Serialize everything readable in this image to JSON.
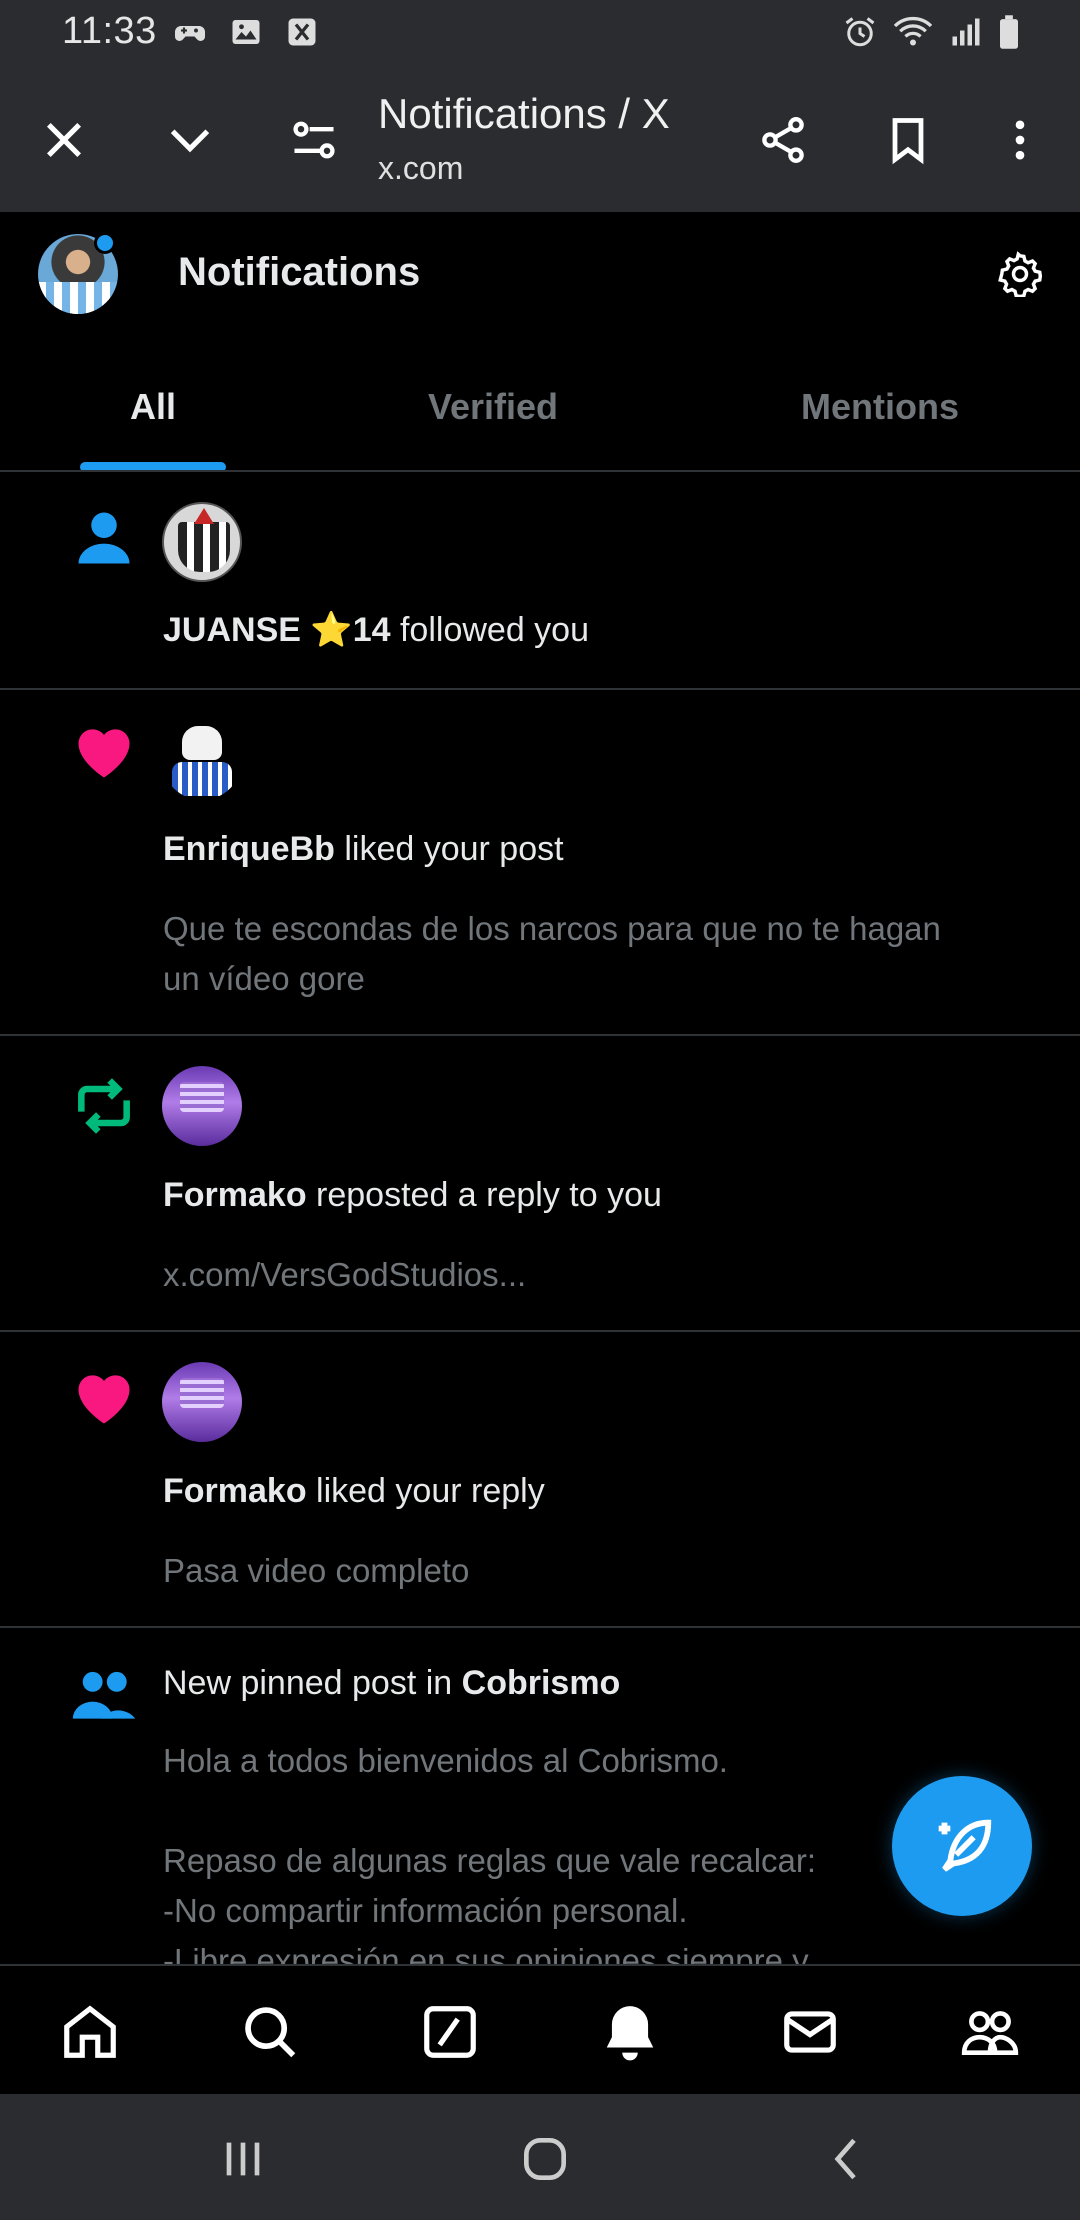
{
  "status_bar": {
    "time": "11:33",
    "left_icons": [
      "game-controller-icon",
      "image-icon",
      "x-app-icon"
    ],
    "right_icons": [
      "alarm-icon",
      "wifi-icon",
      "signal-icon",
      "battery-icon"
    ]
  },
  "browser": {
    "title": "Notifications / X",
    "url": "x.com",
    "buttons": [
      "close-icon",
      "chevron-down-icon",
      "page-settings-icon",
      "share-icon",
      "bookmark-icon",
      "more-vert-icon"
    ]
  },
  "header": {
    "title": "Notifications",
    "settings_icon": "gear-icon"
  },
  "tabs": [
    {
      "label": "All",
      "active": true
    },
    {
      "label": "Verified",
      "active": false
    },
    {
      "label": "Mentions",
      "active": false
    }
  ],
  "notifications": [
    {
      "type": "follow",
      "icon": "person-icon",
      "user": "JUANSE ⭐14",
      "action": " followed you",
      "snippet": ""
    },
    {
      "type": "like",
      "icon": "heart-icon",
      "user": "EnriqueBb",
      "action": " liked your post",
      "snippet": "Que te escondas de los narcos para que no te hagan un vídeo gore"
    },
    {
      "type": "repost",
      "icon": "repost-icon",
      "user": "Formako",
      "action": " reposted a reply to you",
      "snippet": "x.com/VersGodStudios..."
    },
    {
      "type": "like",
      "icon": "heart-icon",
      "user": "Formako",
      "action": " liked your reply",
      "snippet": "Pasa video completo"
    },
    {
      "type": "community",
      "icon": "community-icon",
      "prefix": "New pinned post in ",
      "community": "Cobrismo",
      "line1": "Hola a todos bienvenidos al Cobrismo.",
      "line2": "Repaso de algunas reglas que vale recalcar:",
      "line3": "-No compartir información personal.",
      "line4": "-Libre expresión en sus opiniones siempre y"
    }
  ],
  "fab": {
    "icon": "compose-post-icon"
  },
  "bottom_nav": [
    "home-icon",
    "search-icon",
    "grok-icon",
    "notifications-bell-icon",
    "messages-icon",
    "communities-icon"
  ],
  "system_nav": [
    "recents-icon",
    "home-circle-icon",
    "back-icon"
  ],
  "colors": {
    "accent": "#1d9bf0",
    "like": "#f91880",
    "repost": "#00ba7c",
    "muted_text": "#71767b",
    "divider": "#2f3336",
    "chrome_bg": "#2b2c30"
  }
}
